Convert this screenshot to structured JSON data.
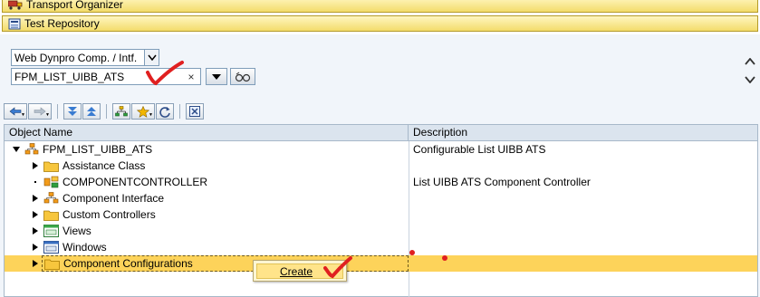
{
  "nav": {
    "transport_label": "Transport Organizer",
    "test_repo_label": "Test Repository"
  },
  "browser": {
    "object_type": "Web Dynpro Comp. / Intf.",
    "object_name": "FPM_LIST_UIBB_ATS",
    "clear_symbol": "×"
  },
  "tree": {
    "columns": [
      "Object Name",
      "Description"
    ],
    "rows": [
      {
        "name": "FPM_LIST_UIBB_ATS",
        "desc": "Configurable List UIBB ATS",
        "icon": "component-icon",
        "expander": "open"
      },
      {
        "name": "Assistance Class",
        "desc": "",
        "icon": "folder-icon",
        "expander": "closed"
      },
      {
        "name": "COMPONENTCONTROLLER",
        "desc": "List UIBB ATS Component Controller",
        "icon": "controller-icon",
        "expander": "leaf"
      },
      {
        "name": "Component Interface",
        "desc": "",
        "icon": "interface-icon",
        "expander": "closed"
      },
      {
        "name": "Custom Controllers",
        "desc": "",
        "icon": "folder-icon",
        "expander": "closed"
      },
      {
        "name": "Views",
        "desc": "",
        "icon": "view-icon",
        "expander": "closed"
      },
      {
        "name": "Windows",
        "desc": "",
        "icon": "window-icon",
        "expander": "closed"
      },
      {
        "name": "Component Configurations",
        "desc": "",
        "icon": "folder-icon",
        "expander": "closed",
        "selected": true
      }
    ]
  },
  "context_menu": {
    "items": [
      "Create"
    ]
  },
  "colors": {
    "selected_row": "#fdd35a",
    "nav_bar": "#f3dc6b",
    "annotation": "#e02020"
  }
}
